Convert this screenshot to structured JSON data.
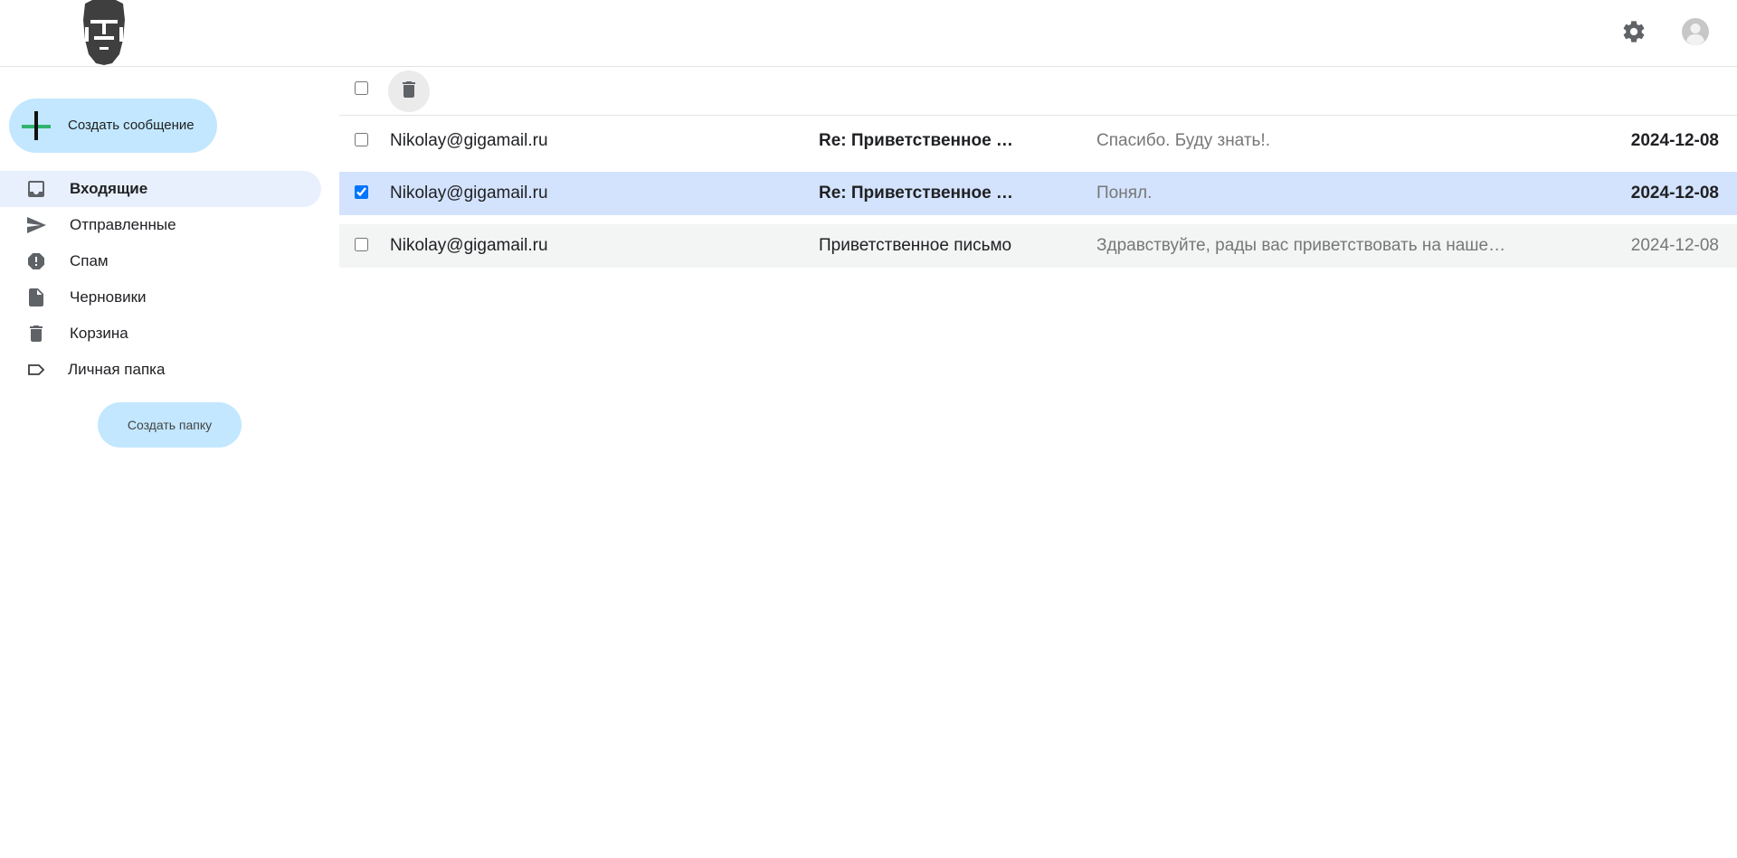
{
  "header": {
    "logo_icon": "bearded-face-logo",
    "settings_icon": "gear-icon",
    "avatar_icon": "user-avatar-icon"
  },
  "sidebar": {
    "compose_label": "Создать сообщение",
    "compose_icon": "plus-icon",
    "items": [
      {
        "label": "Входящие",
        "icon": "inbox-icon",
        "active": true
      },
      {
        "label": "Отправленные",
        "icon": "send-icon",
        "active": false
      },
      {
        "label": "Спам",
        "icon": "spam-icon",
        "active": false
      },
      {
        "label": "Черновики",
        "icon": "draft-icon",
        "active": false
      },
      {
        "label": "Корзина",
        "icon": "trash-icon",
        "active": false
      },
      {
        "label": "Личная папка",
        "icon": "label-icon",
        "active": false
      }
    ],
    "new_folder_label": "Создать папку"
  },
  "toolbar": {
    "delete_icon": "trash-icon"
  },
  "messages": [
    {
      "from": "Nikolay@gigamail.ru",
      "subject": "Re: Приветственное письмо",
      "snippet": "Спасибо. Буду знать!.",
      "date": "2024-12-08",
      "unread": true,
      "selected": false
    },
    {
      "from": "Nikolay@gigamail.ru",
      "subject": "Re: Приветственное письмо",
      "snippet": "Понял.",
      "date": "2024-12-08",
      "unread": true,
      "selected": true
    },
    {
      "from": "Nikolay@gigamail.ru",
      "subject": "Приветственное письмо",
      "snippet": "Здравствуйте, рады вас приветствовать на нашей почте",
      "date": "2024-12-08",
      "unread": false,
      "selected": false
    }
  ],
  "colors": {
    "accent": "#c2e7ff",
    "active_nav": "#e8f0fe",
    "selected_row": "#d3e3fd",
    "read_row": "#f3f4f4",
    "plus_green": "#2fb36f"
  }
}
